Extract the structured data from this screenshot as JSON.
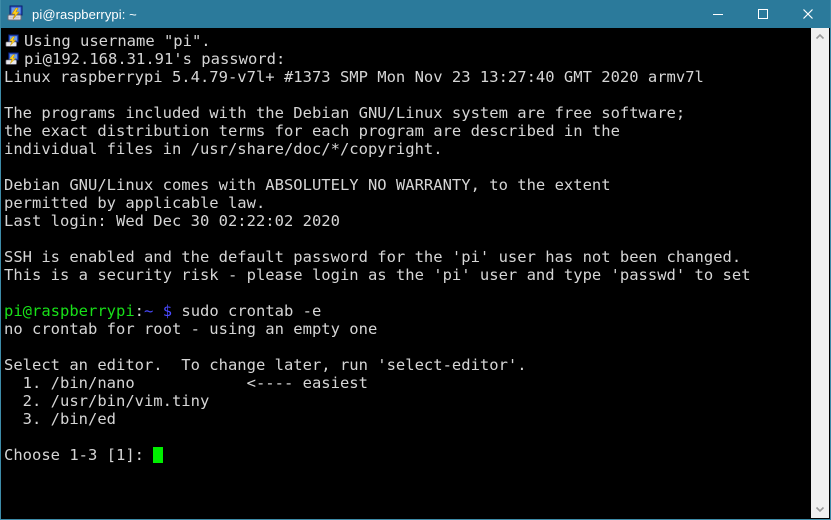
{
  "window": {
    "title": "pi@raspberrypi: ~",
    "app_icon": "putty-icon",
    "titlebar_color": "#2b7a9b",
    "background_color": "#000000",
    "foreground_color": "#d6d6d6",
    "controls": {
      "minimize": "minimize-button",
      "maximize": "maximize-button",
      "close": "close-button"
    }
  },
  "scrollbar": {
    "up_arrow": "scroll-up-arrow",
    "down_arrow": "scroll-down-arrow"
  },
  "terminal": {
    "lines": [
      {
        "id": "l1",
        "icon": true,
        "text": "Using username \"pi\"."
      },
      {
        "id": "l2",
        "icon": true,
        "text": "pi@192.168.31.91's password:"
      },
      {
        "id": "l3",
        "icon": false,
        "text": "Linux raspberrypi 5.4.79-v7l+ #1373 SMP Mon Nov 23 13:27:40 GMT 2020 armv7l"
      },
      {
        "id": "l4",
        "icon": false,
        "text": ""
      },
      {
        "id": "l5",
        "icon": false,
        "text": "The programs included with the Debian GNU/Linux system are free software;"
      },
      {
        "id": "l6",
        "icon": false,
        "text": "the exact distribution terms for each program are described in the"
      },
      {
        "id": "l7",
        "icon": false,
        "text": "individual files in /usr/share/doc/*/copyright."
      },
      {
        "id": "l8",
        "icon": false,
        "text": ""
      },
      {
        "id": "l9",
        "icon": false,
        "text": "Debian GNU/Linux comes with ABSOLUTELY NO WARRANTY, to the extent"
      },
      {
        "id": "l10",
        "icon": false,
        "text": "permitted by applicable law."
      },
      {
        "id": "l11",
        "icon": false,
        "text": "Last login: Wed Dec 30 02:22:02 2020"
      },
      {
        "id": "l12",
        "icon": false,
        "text": ""
      },
      {
        "id": "l13",
        "icon": false,
        "text": "SSH is enabled and the default password for the 'pi' user has not been changed."
      },
      {
        "id": "l14",
        "icon": false,
        "text": "This is a security risk - please login as the 'pi' user and type 'passwd' to set"
      },
      {
        "id": "l15",
        "icon": false,
        "text": ""
      },
      {
        "id": "l17",
        "icon": false,
        "text": "no crontab for root - using an empty one"
      },
      {
        "id": "l18",
        "icon": false,
        "text": ""
      },
      {
        "id": "l19",
        "icon": false,
        "text": "Select an editor.  To change later, run 'select-editor'."
      },
      {
        "id": "l20",
        "icon": false,
        "text": "  1. /bin/nano            <---- easiest"
      },
      {
        "id": "l21",
        "icon": false,
        "text": "  2. /usr/bin/vim.tiny"
      },
      {
        "id": "l22",
        "icon": false,
        "text": "  3. /bin/ed"
      },
      {
        "id": "l23",
        "icon": false,
        "text": ""
      }
    ],
    "prompt": {
      "user_host": "pi@raspberrypi",
      "colon": ":",
      "path": "~",
      "symbol": "$",
      "command": " sudo crontab -e"
    },
    "input_line": {
      "text": "Choose 1-3 [1]: ",
      "cursor": "block-cursor"
    }
  }
}
